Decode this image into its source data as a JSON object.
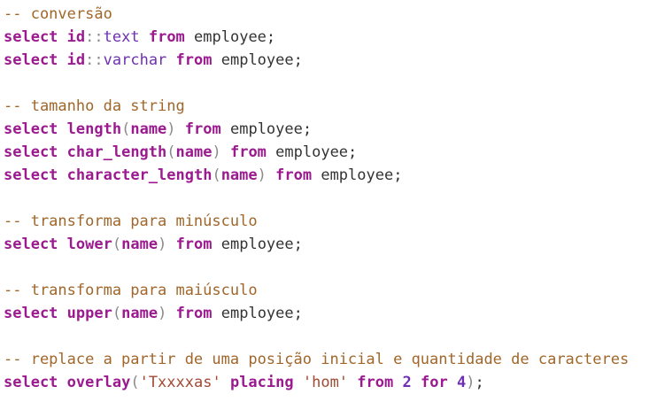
{
  "colors": {
    "comment": "#a0662a",
    "keyword": "#9b1a8f",
    "type": "#6f2fb3",
    "punct": "#8a8a8a",
    "string": "#a04a34",
    "text": "#333333"
  },
  "lines": [
    {
      "tokens": [
        {
          "t": "-- conversão",
          "c": "cm"
        }
      ]
    },
    {
      "tokens": [
        {
          "t": "select",
          "c": "kw"
        },
        {
          "t": " ",
          "c": "tx"
        },
        {
          "t": "id",
          "c": "kw"
        },
        {
          "t": "::",
          "c": "pn"
        },
        {
          "t": "text",
          "c": "ty"
        },
        {
          "t": " ",
          "c": "tx"
        },
        {
          "t": "from",
          "c": "kw"
        },
        {
          "t": " employee;",
          "c": "tx"
        }
      ]
    },
    {
      "tokens": [
        {
          "t": "select",
          "c": "kw"
        },
        {
          "t": " ",
          "c": "tx"
        },
        {
          "t": "id",
          "c": "kw"
        },
        {
          "t": "::",
          "c": "pn"
        },
        {
          "t": "varchar",
          "c": "ty"
        },
        {
          "t": " ",
          "c": "tx"
        },
        {
          "t": "from",
          "c": "kw"
        },
        {
          "t": " employee;",
          "c": "tx"
        }
      ]
    },
    {
      "tokens": []
    },
    {
      "tokens": [
        {
          "t": "-- tamanho da string",
          "c": "cm"
        }
      ]
    },
    {
      "tokens": [
        {
          "t": "select",
          "c": "kw"
        },
        {
          "t": " ",
          "c": "tx"
        },
        {
          "t": "length",
          "c": "kw"
        },
        {
          "t": "(",
          "c": "pn"
        },
        {
          "t": "name",
          "c": "kw"
        },
        {
          "t": ")",
          "c": "pn"
        },
        {
          "t": " ",
          "c": "tx"
        },
        {
          "t": "from",
          "c": "kw"
        },
        {
          "t": " employee;",
          "c": "tx"
        }
      ]
    },
    {
      "tokens": [
        {
          "t": "select",
          "c": "kw"
        },
        {
          "t": " ",
          "c": "tx"
        },
        {
          "t": "char_length",
          "c": "kw"
        },
        {
          "t": "(",
          "c": "pn"
        },
        {
          "t": "name",
          "c": "kw"
        },
        {
          "t": ")",
          "c": "pn"
        },
        {
          "t": " ",
          "c": "tx"
        },
        {
          "t": "from",
          "c": "kw"
        },
        {
          "t": " employee;",
          "c": "tx"
        }
      ]
    },
    {
      "tokens": [
        {
          "t": "select",
          "c": "kw"
        },
        {
          "t": " ",
          "c": "tx"
        },
        {
          "t": "character_length",
          "c": "kw"
        },
        {
          "t": "(",
          "c": "pn"
        },
        {
          "t": "name",
          "c": "kw"
        },
        {
          "t": ")",
          "c": "pn"
        },
        {
          "t": " ",
          "c": "tx"
        },
        {
          "t": "from",
          "c": "kw"
        },
        {
          "t": " employee;",
          "c": "tx"
        }
      ]
    },
    {
      "tokens": []
    },
    {
      "tokens": [
        {
          "t": "-- transforma para minúsculo",
          "c": "cm"
        }
      ]
    },
    {
      "tokens": [
        {
          "t": "select",
          "c": "kw"
        },
        {
          "t": " ",
          "c": "tx"
        },
        {
          "t": "lower",
          "c": "kw"
        },
        {
          "t": "(",
          "c": "pn"
        },
        {
          "t": "name",
          "c": "kw"
        },
        {
          "t": ")",
          "c": "pn"
        },
        {
          "t": " ",
          "c": "tx"
        },
        {
          "t": "from",
          "c": "kw"
        },
        {
          "t": " employee;",
          "c": "tx"
        }
      ]
    },
    {
      "tokens": []
    },
    {
      "tokens": [
        {
          "t": "-- transforma para maiúsculo",
          "c": "cm"
        }
      ]
    },
    {
      "tokens": [
        {
          "t": "select",
          "c": "kw"
        },
        {
          "t": " ",
          "c": "tx"
        },
        {
          "t": "upper",
          "c": "kw"
        },
        {
          "t": "(",
          "c": "pn"
        },
        {
          "t": "name",
          "c": "kw"
        },
        {
          "t": ")",
          "c": "pn"
        },
        {
          "t": " ",
          "c": "tx"
        },
        {
          "t": "from",
          "c": "kw"
        },
        {
          "t": " employee;",
          "c": "tx"
        }
      ]
    },
    {
      "tokens": []
    },
    {
      "tokens": [
        {
          "t": "-- replace a partir de uma posição inicial e quantidade de caracteres",
          "c": "cm"
        }
      ]
    },
    {
      "tokens": [
        {
          "t": "select",
          "c": "kw"
        },
        {
          "t": " ",
          "c": "tx"
        },
        {
          "t": "overlay",
          "c": "kw"
        },
        {
          "t": "(",
          "c": "pn"
        },
        {
          "t": "'Txxxxas'",
          "c": "st"
        },
        {
          "t": " ",
          "c": "tx"
        },
        {
          "t": "placing",
          "c": "kw"
        },
        {
          "t": " ",
          "c": "tx"
        },
        {
          "t": "'hom'",
          "c": "st"
        },
        {
          "t": " ",
          "c": "tx"
        },
        {
          "t": "from",
          "c": "kw"
        },
        {
          "t": " ",
          "c": "tx"
        },
        {
          "t": "2",
          "c": "nm"
        },
        {
          "t": " ",
          "c": "tx"
        },
        {
          "t": "for",
          "c": "kw"
        },
        {
          "t": " ",
          "c": "tx"
        },
        {
          "t": "4",
          "c": "nm"
        },
        {
          "t": ")",
          "c": "pn"
        },
        {
          "t": ";",
          "c": "tx"
        }
      ]
    }
  ]
}
